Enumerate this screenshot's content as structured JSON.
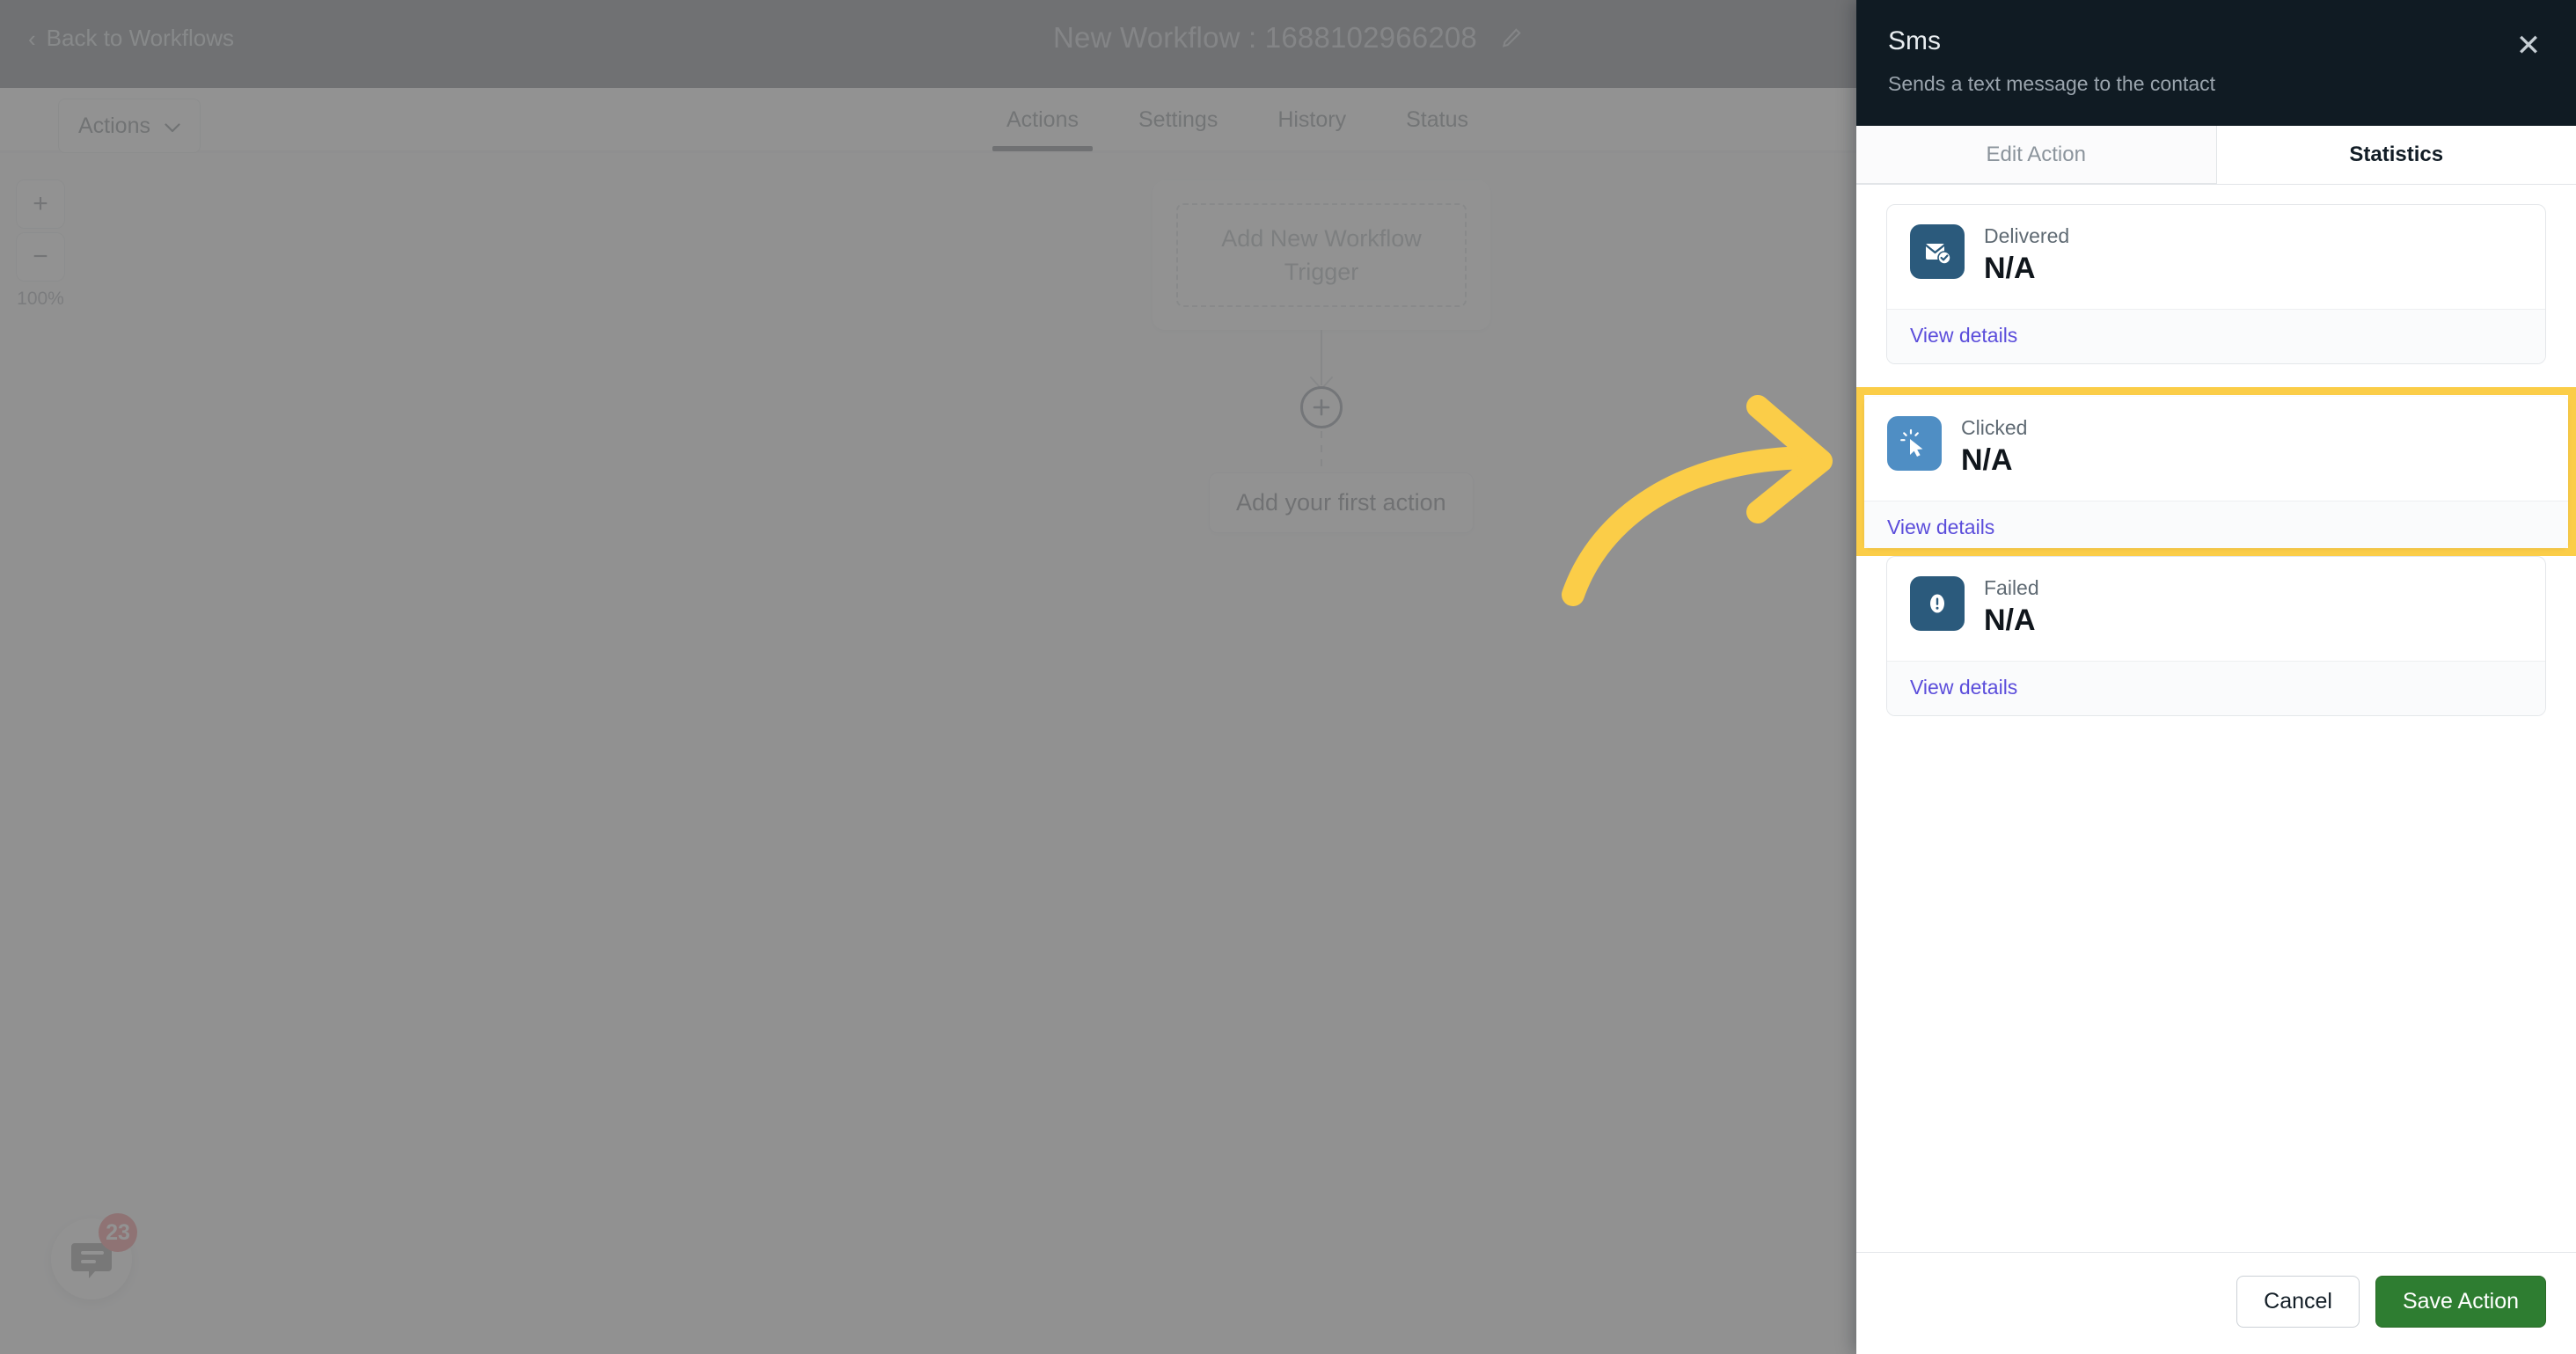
{
  "header": {
    "back_label": "Back to Workflows",
    "back_icon": "chevron-left-icon",
    "workflow_title": "New Workflow : 1688102966208",
    "edit_icon": "pencil-icon"
  },
  "subheader": {
    "actions_dropdown_label": "Actions",
    "dropdown_icon": "chevron-down-icon",
    "tabs": [
      {
        "label": "Actions",
        "active": true
      },
      {
        "label": "Settings",
        "active": false
      },
      {
        "label": "History",
        "active": false
      },
      {
        "label": "Status",
        "active": false
      }
    ]
  },
  "canvas": {
    "zoom_in_label": "+",
    "zoom_out_label": "−",
    "zoom_level": "100%",
    "trigger_node_label": "Add New Workflow Trigger",
    "add_node_icon": "plus-circle-icon",
    "first_action_label": "Add your first action",
    "chat_widget_icon": "chat-bubble-icon",
    "chat_badge_count": "23"
  },
  "panel": {
    "title": "Sms",
    "subtitle": "Sends a text message to the contact",
    "close_icon": "close-icon",
    "tabs": [
      {
        "label": "Edit Action",
        "active": false
      },
      {
        "label": "Statistics",
        "active": true
      }
    ],
    "stats": [
      {
        "label": "Delivered",
        "value": "N/A",
        "link": "View details",
        "icon": "envelope-check-icon",
        "icon_color": "#2b5a7c",
        "highlighted": false
      },
      {
        "label": "Clicked",
        "value": "N/A",
        "link": "View details",
        "icon": "cursor-click-icon",
        "icon_color": "#4f8ec4",
        "highlighted": true
      },
      {
        "label": "Failed",
        "value": "N/A",
        "link": "View details",
        "icon": "exclamation-icon",
        "icon_color": "#2b5a7c",
        "highlighted": false
      }
    ],
    "cancel_label": "Cancel",
    "save_label": "Save Action"
  },
  "annotation": {
    "arrow_icon": "curved-arrow-right-icon",
    "highlight_color": "#fbcd48",
    "arrow_color": "#fbcd48"
  },
  "colors": {
    "header_bg": "#101b23",
    "accent_link": "#5b4ddb",
    "save_green": "#2e7d31",
    "badge_red": "#e8262b",
    "highlight_yellow": "#fbcd48"
  }
}
